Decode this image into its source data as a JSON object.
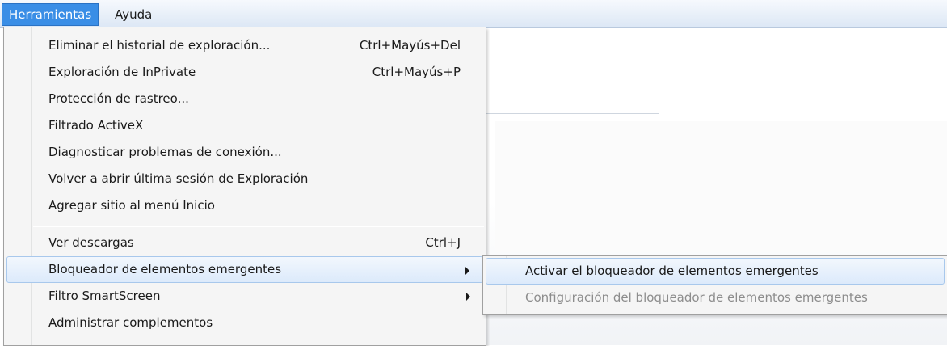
{
  "menubar": {
    "items": [
      {
        "label": "Herramientas"
      },
      {
        "label": "Ayuda"
      }
    ]
  },
  "tools_menu": {
    "items": [
      {
        "label": "Eliminar el historial de exploración...",
        "shortcut": "Ctrl+Mayús+Del"
      },
      {
        "label": "Exploración de InPrivate",
        "shortcut": "Ctrl+Mayús+P"
      },
      {
        "label": "Protección de rastreo..."
      },
      {
        "label": "Filtrado ActiveX"
      },
      {
        "label": "Diagnosticar problemas de conexión..."
      },
      {
        "label": "Volver a abrir última sesión de Exploración"
      },
      {
        "label": "Agregar sitio al menú Inicio"
      },
      {
        "label": "Ver descargas",
        "shortcut": "Ctrl+J"
      },
      {
        "label": "Bloqueador de elementos emergentes"
      },
      {
        "label": "Filtro SmartScreen"
      },
      {
        "label": "Administrar complementos"
      }
    ]
  },
  "popup_submenu": {
    "items": [
      {
        "label": "Activar el bloqueador de elementos emergentes"
      },
      {
        "label": "Configuración del bloqueador de elementos emergentes"
      }
    ]
  },
  "colors": {
    "menubar_active": "#3a8ee6",
    "highlight_border": "#a8c8ec",
    "disabled_text": "#8d8d8d"
  }
}
